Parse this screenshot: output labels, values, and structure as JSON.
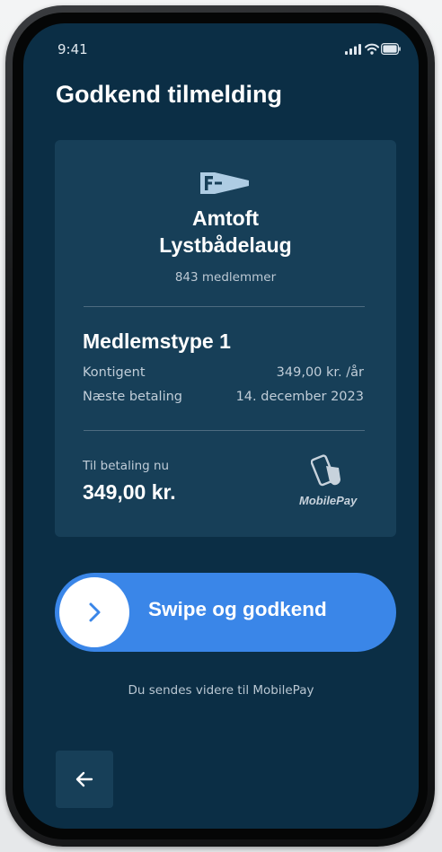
{
  "status_bar": {
    "time": "9:41",
    "icons": [
      "signal-icon",
      "wifi-icon",
      "battery-icon"
    ]
  },
  "page": {
    "title": "Godkend tilmelding"
  },
  "club": {
    "logo": "pennant-flag-logo",
    "name_line1": "Amtoft",
    "name_line2": "Lystbådelaug",
    "members": "843 medlemmer"
  },
  "membership": {
    "type": "Medlemstype 1",
    "fee_label": "Kontigent",
    "fee_value": "349,00 kr. /år",
    "next_label": "Næste betaling",
    "next_value": "14. december 2023"
  },
  "payment": {
    "label": "Til betaling nu",
    "amount": "349,00 kr.",
    "provider": "MobilePay",
    "provider_icon": "mobilepay-icon"
  },
  "swipe": {
    "label": "Swipe og godkend",
    "icon": "chevron-right-icon"
  },
  "redirect_note": "Du sendes videre til MobilePay",
  "back": {
    "icon": "arrow-left-icon"
  },
  "colors": {
    "screen_bg": "#0b2e45",
    "card_bg": "#173f58",
    "accent": "#3a86e8",
    "text_primary": "#ffffff",
    "text_secondary": "#c0cdd8"
  }
}
